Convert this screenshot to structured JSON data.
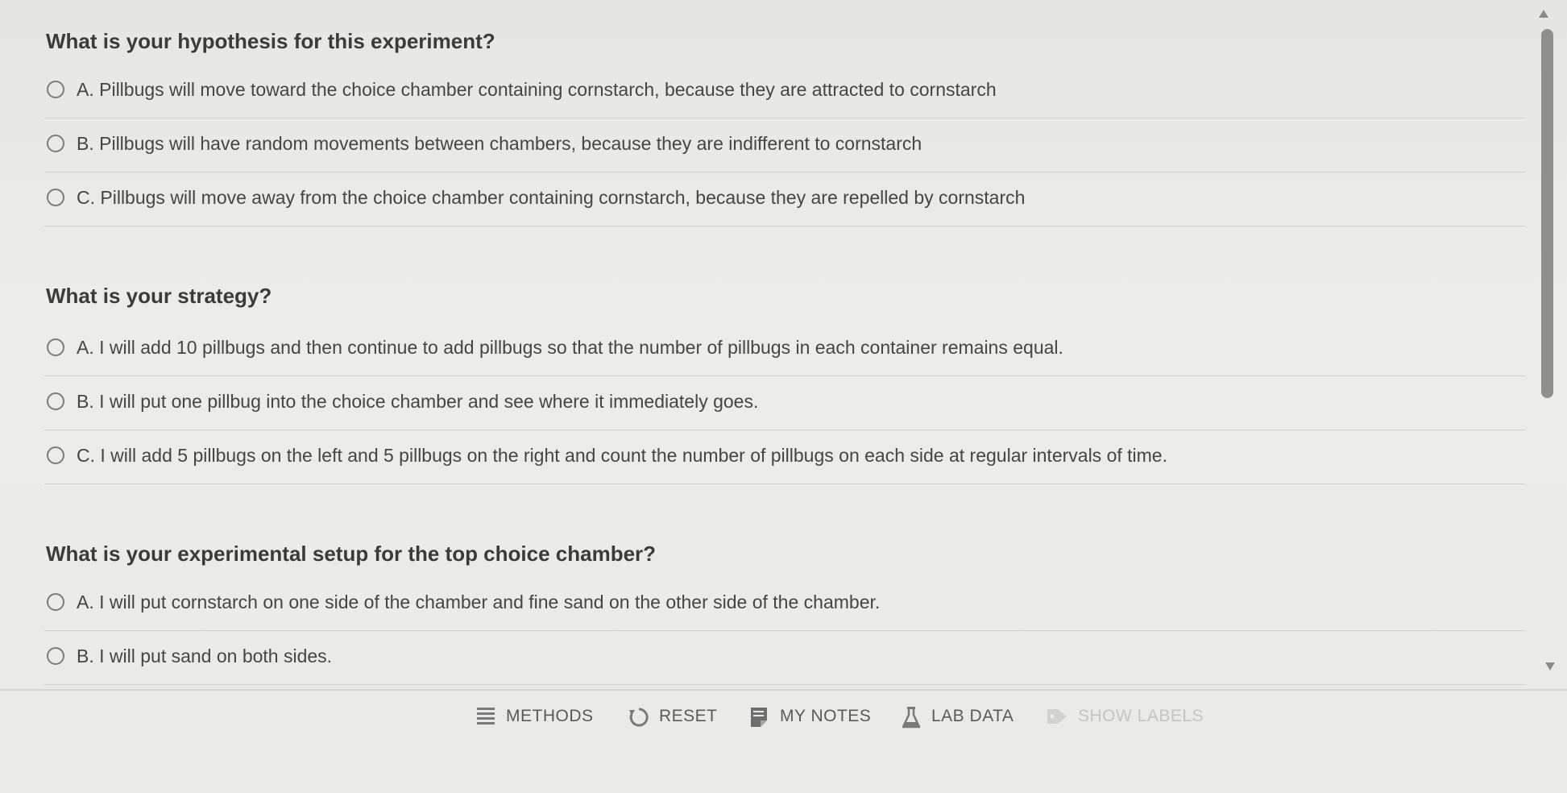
{
  "sections": [
    {
      "question": "What is your hypothesis for this experiment?",
      "options": [
        "A. Pillbugs will move toward the choice chamber containing cornstarch, because they are attracted to cornstarch",
        "B. Pillbugs will have random movements between chambers, because they are indifferent to cornstarch",
        "C. Pillbugs will move away from the choice chamber containing cornstarch, because they are repelled by cornstarch"
      ]
    },
    {
      "question": "What is your strategy?",
      "options": [
        "A. I will add 10 pillbugs and then continue to add pillbugs so that the number of pillbugs in each container remains equal.",
        "B. I will put one pillbug into the choice chamber and see where it immediately goes.",
        "C. I will add 5 pillbugs on the left and 5 pillbugs on the right and count the number of pillbugs on each side at regular intervals of time."
      ]
    },
    {
      "question": "What is your experimental setup for the top choice chamber?",
      "options": [
        "A. I will put cornstarch on one side of the chamber and fine sand on the other side of the chamber.",
        "B. I will put sand on both sides."
      ]
    }
  ],
  "toolbar": {
    "methods": "METHODS",
    "reset": "RESET",
    "my_notes": "MY NOTES",
    "lab_data": "LAB DATA",
    "show_labels": "SHOW LABELS",
    "icons": [
      "list-icon",
      "reset-icon",
      "notes-icon",
      "flask-icon",
      "tag-icon"
    ]
  }
}
